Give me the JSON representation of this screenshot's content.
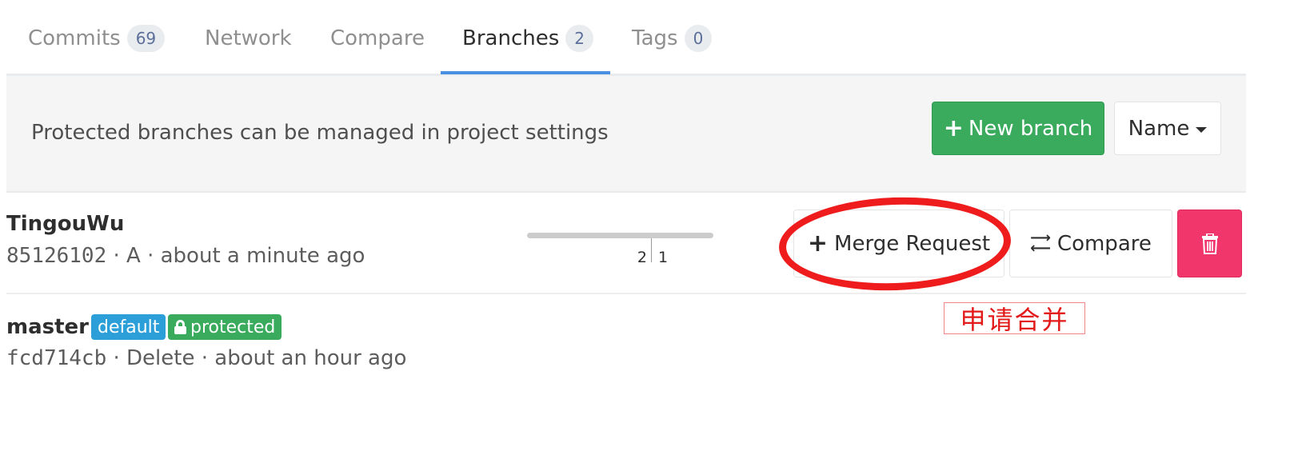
{
  "tabs": [
    {
      "label": "Commits",
      "count": "69"
    },
    {
      "label": "Network"
    },
    {
      "label": "Compare"
    },
    {
      "label": "Branches",
      "count": "2"
    },
    {
      "label": "Tags",
      "count": "0"
    }
  ],
  "active_tab": "Branches",
  "notice": {
    "text": "Protected branches can be managed in project settings",
    "new_branch_label": "New branch",
    "sort_label": "Name"
  },
  "branches": [
    {
      "name": "TingouWu",
      "sha": "85126102",
      "message": "A",
      "time": "about a minute ago",
      "behind": "2",
      "ahead": "1",
      "merge_request_label": "Merge Request",
      "compare_label": "Compare"
    },
    {
      "name": "master",
      "badges": [
        "default",
        "protected"
      ],
      "sha": "fcd714cb",
      "message": "Delete",
      "time": "about an hour ago"
    }
  ],
  "separator": "·",
  "annotation": {
    "text": "申请合并",
    "color": "#e21a1a"
  },
  "colors": {
    "accent": "#4a90e2",
    "success": "#3aaa5d",
    "danger": "#f0366a",
    "info": "#2d9fd8"
  },
  "icons": [
    "plus-icon",
    "caret-down-icon",
    "swap-icon",
    "trash-icon",
    "lock-icon"
  ]
}
